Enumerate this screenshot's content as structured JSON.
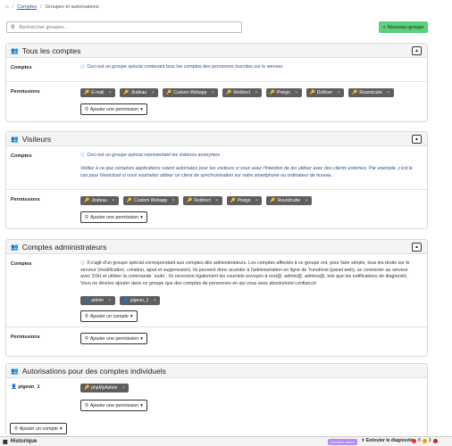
{
  "breadcrumb": {
    "items": [
      "Comptes",
      "Groupes et autorisations"
    ]
  },
  "search": {
    "placeholder": "Rechercher groupes..."
  },
  "new_group_label": "Nouveau groupe",
  "colors": {
    "accent": "#5bd07a",
    "tag": "#5e5e5e",
    "link": "#2a62b8"
  },
  "cards": {
    "all": {
      "title": "Tous les comptes",
      "accounts_label": "Comptes",
      "accounts_info": "Ceci est un groupe spécial contenant tous les comptes des personnes inscrites sur le serveur",
      "permissions_label": "Permissions",
      "permissions": [
        "E-mail",
        "Jirafeau",
        "Custom Webapp",
        "Redirect",
        "Piwigo",
        "Dolibarr",
        "Roundcube"
      ],
      "add_permission": "Ajouter une permission"
    },
    "visitors": {
      "title": "Visiteurs",
      "accounts_label": "Comptes",
      "accounts_info": "Ceci est un groupe spécial représentant les visiteurs anonymes",
      "warning": "Veillez à ce que certaines applications soient autorisées pour les visiteurs si vous avez l'intention de les utiliser avec des clients externes. Par exemple, c'est le cas pour Nextcloud si vous souhaitez utiliser un client de synchronisation sur votre smartphone ou ordinateur de bureau.",
      "permissions_label": "Permissions",
      "permissions": [
        "Jirafeau",
        "Custom Webapp",
        "Redirect",
        "Piwigo",
        "Roundcube"
      ],
      "add_permission": "Ajouter une permission"
    },
    "admins": {
      "title": "Comptes administrateurs",
      "accounts_label": "Comptes",
      "accounts_info": "Il s'agit d'un groupe spécial correspondant aux comptes dits administrateurs. Les comptes affectés à ce groupe ont, pour faire simple, tous les droits sur le serveur (modification, création, ajout et suppression). Ils peuvent donc accéder à l'administration en ligne de YunoHost (panel web), se connecter au serveur avec SSH et utiliser la commande `sudo`. Ils recevront également les courriels envoyés à root@, admin@, admins@, tels que les notifications de diagnostic. Vous ne devriez ajouter dans ce groupe que des comptes de personnes en qui vous avez absolument confiance!",
      "members": [
        "admin",
        "pigeon_1"
      ],
      "add_account": "Ajouter un compte",
      "permissions_label": "Permissions",
      "add_permission": "Ajouter une permission"
    },
    "individual": {
      "title": "Autorisations pour des comptes individuels",
      "user": "pigeon_1",
      "permissions": [
        "phpMyAdmin"
      ],
      "add_permission": "Ajouter une permission",
      "add_account": "Ajouter un compte"
    }
  },
  "footer": {
    "history": "Historique",
    "badge": "Dernière action",
    "diagnosis": "Exécuter le diagnostic",
    "count_errors": "8",
    "count_warnings": "3"
  }
}
